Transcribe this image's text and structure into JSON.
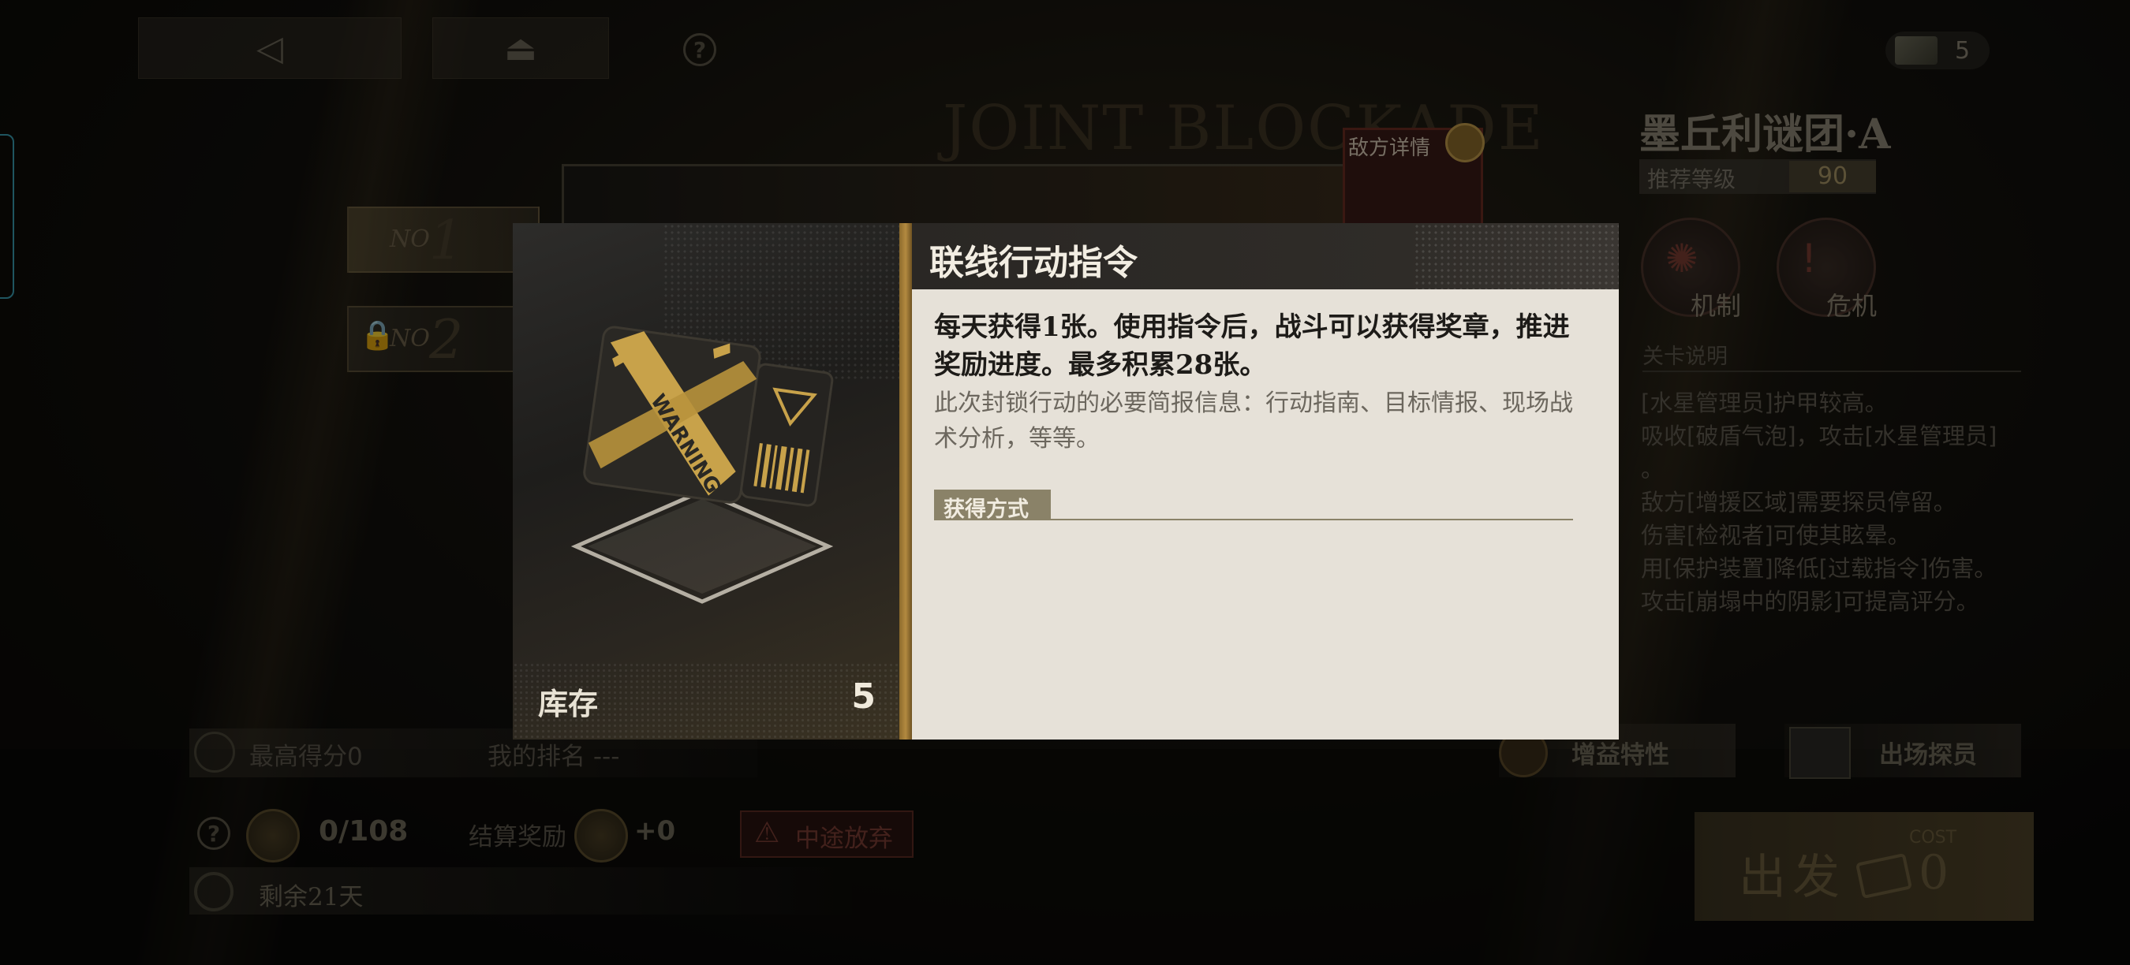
{
  "top": {
    "help_glyph": "?",
    "currency_count": "5"
  },
  "background": {
    "title": "JOINT BLOCKADE",
    "enemy_detail": "敌方详情"
  },
  "stages": [
    {
      "no": "NO",
      "num": "1",
      "locked": false
    },
    {
      "no": "NO",
      "num": "2",
      "locked": true
    }
  ],
  "right_panel": {
    "title": "墨丘利谜团·A",
    "recommended_label": "推荐等级",
    "recommended_value": "90",
    "mechanism_label": "机制",
    "crisis_label": "危机",
    "section_label": "关卡说明",
    "description": [
      "[水星管理员]护甲较高。",
      "吸收[破盾气泡]，攻击[水星管理员]",
      "。",
      "敌方[增援区域]需要探员停留。",
      "伤害[检视者]可使其眩晕。",
      "用[保护装置]降低[过载指令]伤害。",
      "攻击[崩塌中的阴影]可提高评分。"
    ]
  },
  "bottom": {
    "best_score": "最高得分0",
    "my_rank": "我的排名 ---",
    "progress": "0/108",
    "settle_reward_label": "结算奖励",
    "settle_reward_value": "+0",
    "abandon": "中途放弃",
    "remaining": "剩余21天",
    "buff_traits": "增益特性",
    "deploy_agents": "出场探员",
    "depart": "出发",
    "cost_label": "COST",
    "cost_value": "0"
  },
  "modal": {
    "title": "联线行动指令",
    "main_text": "每天获得1张。使用指令后，战斗可以获得奖章，推进奖励进度。最多积累28张。",
    "sub_text": "此次封锁行动的必要简报信息：行动指南、目标情报、现场战术分析，等等。",
    "acquire_label": "获得方式",
    "stock_label": "库存",
    "stock_value": "5",
    "ticket_text": "WARNING",
    "accent": "#b38a40"
  }
}
